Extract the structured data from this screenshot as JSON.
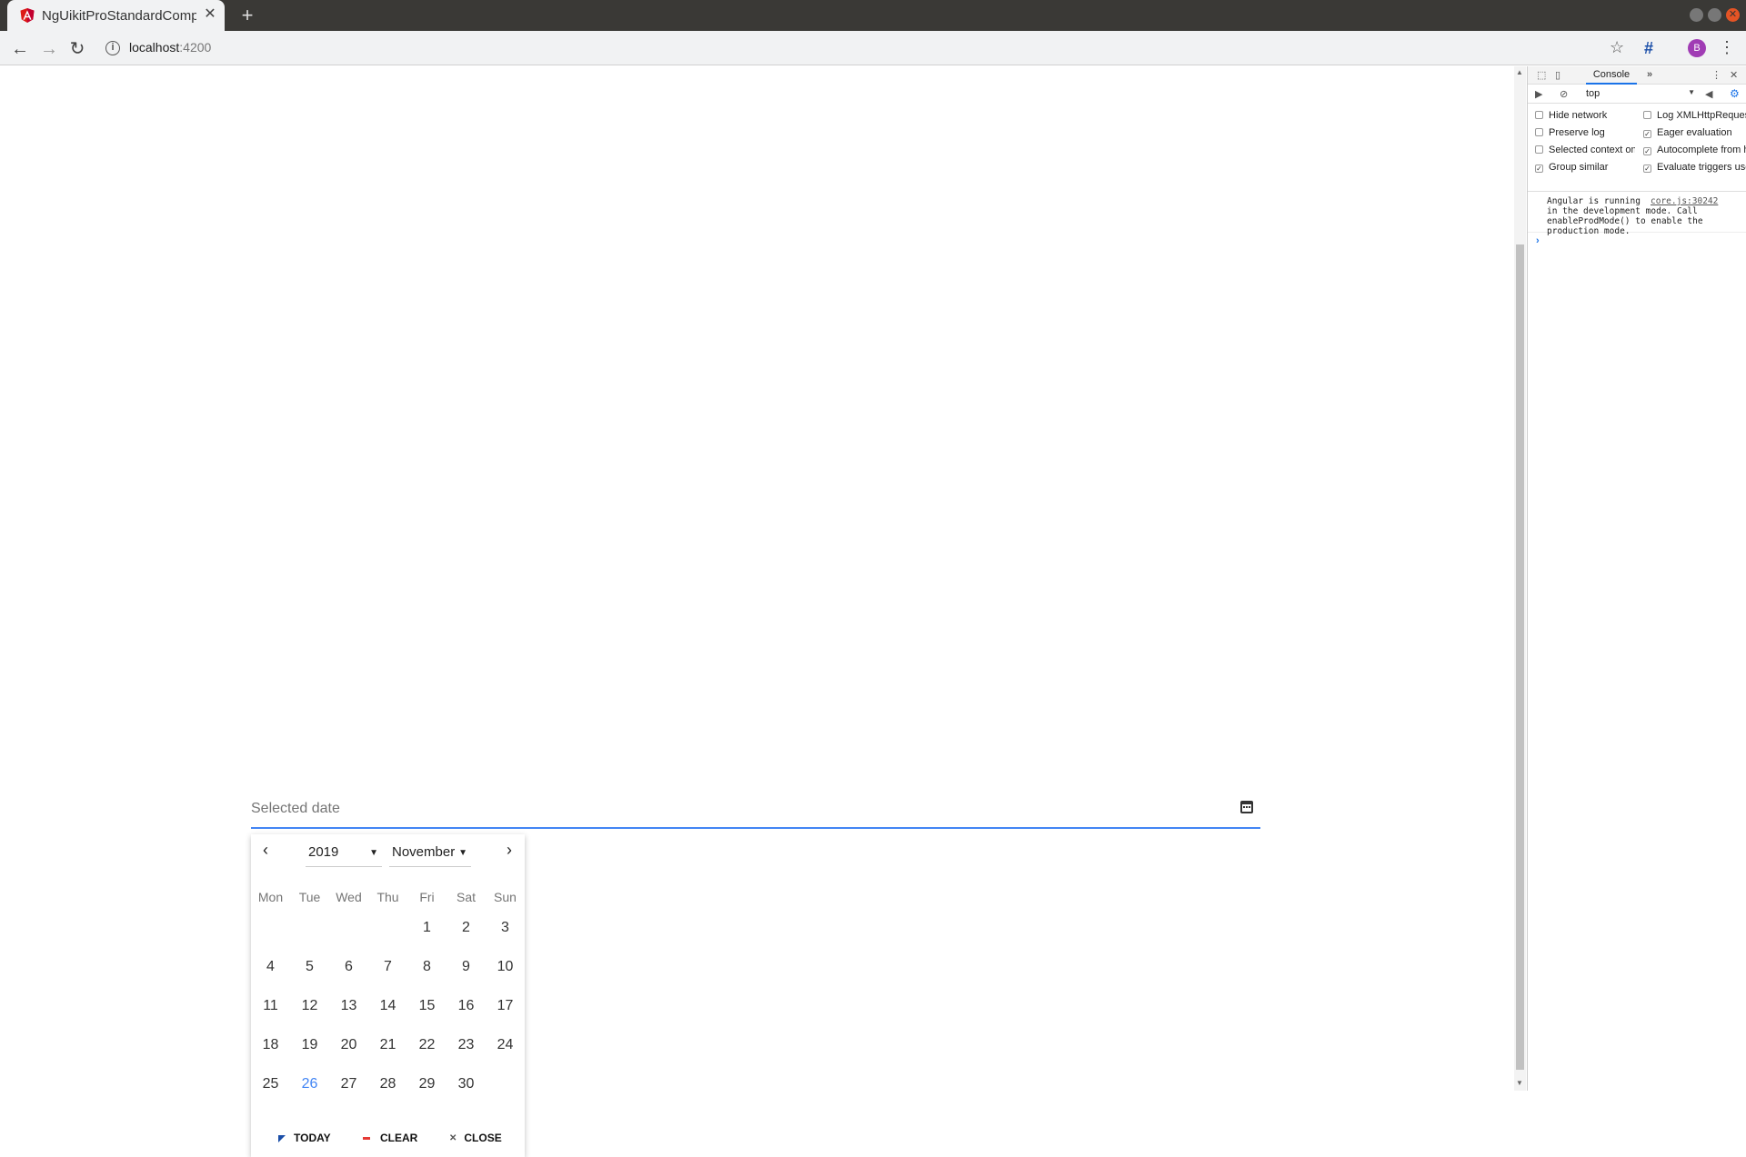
{
  "browser": {
    "tab_title": "NgUikitProStandardComponent",
    "new_tab_icon": "+",
    "url_host": "localhost",
    "url_port": ":4200",
    "profile_initial": "B"
  },
  "date_input": {
    "placeholder": "Selected date"
  },
  "datepicker": {
    "year": "2019",
    "month": "November",
    "weekdays": [
      "Mon",
      "Tue",
      "Wed",
      "Thu",
      "Fri",
      "Sat",
      "Sun"
    ],
    "leading_blanks": 4,
    "days": [
      "1",
      "2",
      "3",
      "4",
      "5",
      "6",
      "7",
      "8",
      "9",
      "10",
      "11",
      "12",
      "13",
      "14",
      "15",
      "16",
      "17",
      "18",
      "19",
      "20",
      "21",
      "22",
      "23",
      "24",
      "25",
      "26",
      "27",
      "28",
      "29",
      "30"
    ],
    "highlighted_day": "26",
    "highlight_color": "#4285f4",
    "buttons": {
      "today": "TODAY",
      "clear": "CLEAR",
      "close": "CLOSE"
    }
  },
  "devtools": {
    "active_tab": "Console",
    "context": "top",
    "options": [
      {
        "label": "Hide network",
        "checked": false
      },
      {
        "label": "Log XMLHttpRequests",
        "checked": false
      },
      {
        "label": "Preserve log",
        "checked": false
      },
      {
        "label": "Eager evaluation",
        "checked": true
      },
      {
        "label": "Selected context only",
        "checked": false
      },
      {
        "label": "Autocomplete from history",
        "checked": true
      },
      {
        "label": "Group similar",
        "checked": true
      },
      {
        "label": "Evaluate triggers user activation",
        "checked": true
      }
    ],
    "message": "Angular is running\nin the development mode. Call\nenableProdMode() to enable the\nproduction mode.",
    "message_source": "core.js:30242"
  }
}
